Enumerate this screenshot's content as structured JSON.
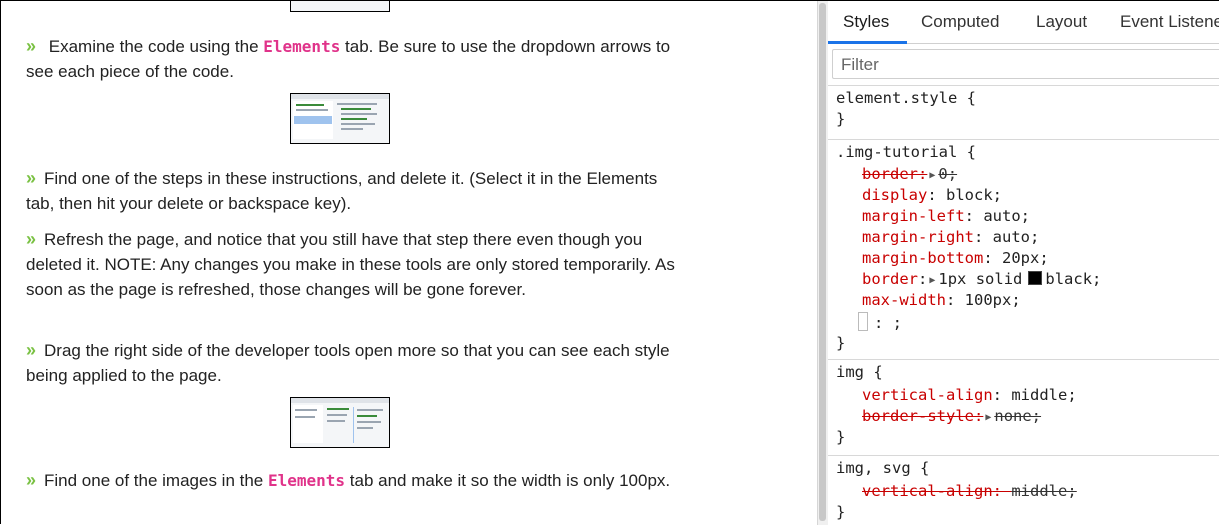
{
  "tutorial": {
    "steps": [
      {
        "marker": "»",
        "pre": " Examine the code using the ",
        "code": "Elements",
        "post": " tab. Be sure to use the dropdown arrows to see each piece of the code."
      },
      {
        "marker": "»",
        "pre": "Find one of the steps in these instructions, and delete it. (Select it in the Elements tab, then hit your delete or backspace key).",
        "code": "",
        "post": ""
      },
      {
        "marker": "»",
        "pre": "Refresh the page, and notice that you still have that step there even though you deleted it. NOTE: Any changes you make in these tools are only stored temporarily. As soon as the page is refreshed, those changes will be gone forever.",
        "code": "",
        "post": ""
      },
      {
        "marker": "»",
        "pre": "Drag the right side of the developer tools open more so that you can see each style being applied to the page.",
        "code": "",
        "post": ""
      },
      {
        "marker": "»",
        "pre": "Find one of the images in the ",
        "code": "Elements",
        "post": " tab and make it so the width is only 100px."
      }
    ]
  },
  "devtools": {
    "tabs": [
      "Styles",
      "Computed",
      "Layout",
      "Event Listeners"
    ],
    "active_tab": "Styles",
    "filter_placeholder": "Filter",
    "rules": [
      {
        "selector": "element.style {",
        "close": "}"
      },
      {
        "selector": ".img-tutorial {",
        "close": "}",
        "decls": [
          {
            "prop": "border",
            "val": "0;",
            "struck": true,
            "triangle": true
          },
          {
            "prop": "display",
            "val": "block;"
          },
          {
            "prop": "margin-left",
            "val": "auto;"
          },
          {
            "prop": "margin-right",
            "val": "auto;"
          },
          {
            "prop": "margin-bottom",
            "val": "20px;"
          },
          {
            "prop": "border",
            "val": "1px solid",
            "val2": "black;",
            "triangle": true,
            "swatch": true
          },
          {
            "prop": "max-width",
            "val": "100px;"
          },
          {
            "prop": "",
            "val": ": ;",
            "editing": true
          }
        ]
      },
      {
        "selector": "img {",
        "close": "}",
        "decls": [
          {
            "prop": "vertical-align",
            "val": "middle;"
          },
          {
            "prop": "border-style",
            "val": "none;",
            "struck": true,
            "triangle": true
          }
        ]
      },
      {
        "selector": "img, svg {",
        "close": "}",
        "decls": [
          {
            "prop": "vertical-align",
            "val": "middle;",
            "struck": true
          }
        ]
      }
    ],
    "accent_color": "#1a73e8",
    "property_color": "#c80000"
  },
  "colors": {
    "chevron": "#7ac143",
    "code_keyword": "#e0338a"
  }
}
